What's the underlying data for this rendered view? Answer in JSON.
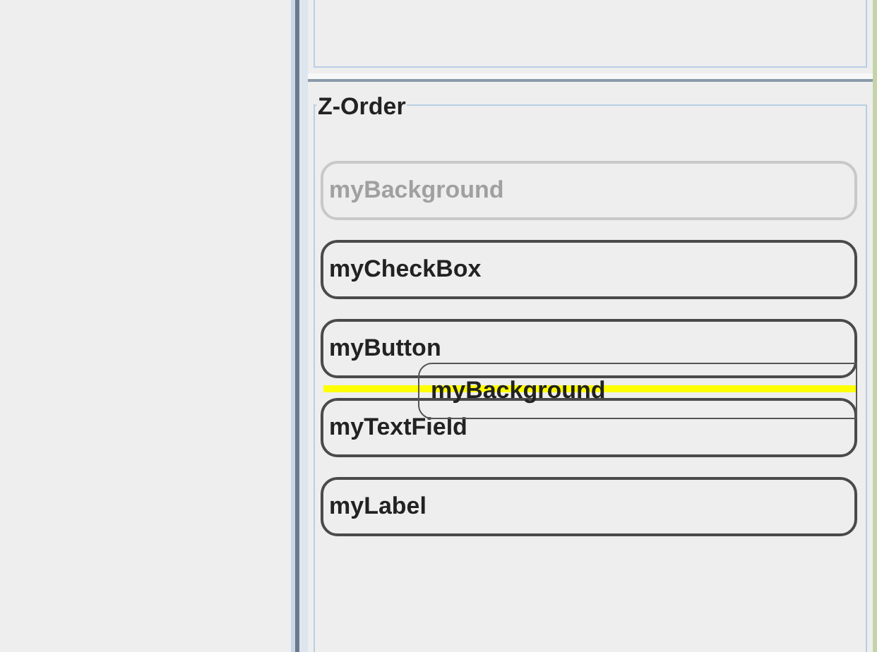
{
  "z_order": {
    "title": "Z-Order",
    "items": [
      {
        "label": "myBackground",
        "disabled": true,
        "drop_below": false
      },
      {
        "label": "myCheckBox",
        "disabled": false,
        "drop_below": false
      },
      {
        "label": "myButton",
        "disabled": false,
        "drop_below": true
      },
      {
        "label": "myTextField",
        "disabled": false,
        "drop_below": false
      },
      {
        "label": "myLabel",
        "disabled": false,
        "drop_below": false
      }
    ],
    "drag_ghost": {
      "label": "myBackground"
    }
  }
}
